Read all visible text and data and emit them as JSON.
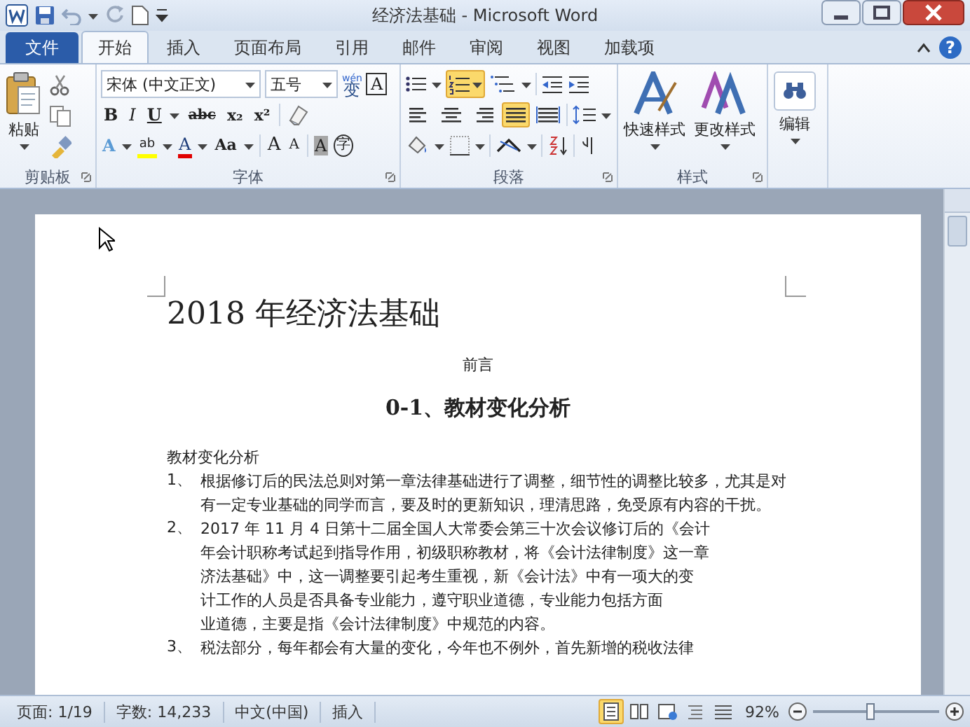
{
  "window": {
    "title": "经济法基础 - Microsoft Word",
    "help": "?"
  },
  "tabs": [
    {
      "label": "文件",
      "kind": "file",
      "selected": false
    },
    {
      "label": "开始",
      "kind": "tab",
      "selected": true
    },
    {
      "label": "插入",
      "kind": "tab",
      "selected": false
    },
    {
      "label": "页面布局",
      "kind": "tab",
      "selected": false
    },
    {
      "label": "引用",
      "kind": "tab",
      "selected": false
    },
    {
      "label": "邮件",
      "kind": "tab",
      "selected": false
    },
    {
      "label": "审阅",
      "kind": "tab",
      "selected": false
    },
    {
      "label": "视图",
      "kind": "tab",
      "selected": false
    },
    {
      "label": "加载项",
      "kind": "tab",
      "selected": false
    }
  ],
  "clipboard": {
    "label": "剪贴板",
    "paste": "粘贴"
  },
  "font": {
    "label": "字体",
    "font_name": "宋体 (中文正文)",
    "font_size": "五号",
    "phonetic": {
      "ruby": "wén",
      "base": "变"
    },
    "border_char": "A",
    "format_buttons": [
      {
        "label": "B",
        "kind": "bold"
      },
      {
        "label": "I",
        "kind": "italic"
      },
      {
        "label": "U",
        "kind": "underline"
      },
      {
        "label": "abc",
        "kind": "strike"
      },
      {
        "label": "x₂",
        "kind": "plain"
      },
      {
        "label": "x²",
        "kind": "plain"
      }
    ],
    "effect_buttons": [
      {
        "label": "A",
        "kind": "effects"
      },
      {
        "label": "ab",
        "kind": "highlight"
      },
      {
        "label": "A",
        "kind": "color"
      },
      {
        "label": "Aa",
        "kind": "plain"
      },
      {
        "label": "A",
        "kind": "grow"
      },
      {
        "label": "A",
        "kind": "shrink"
      },
      {
        "label": "A",
        "kind": "shade"
      },
      {
        "label": "字",
        "kind": "enclose"
      }
    ]
  },
  "paragraph": {
    "label": "段落",
    "numbering": {
      "selected": true
    },
    "align": [
      {
        "selected": false
      },
      {
        "selected": false
      },
      {
        "selected": false
      },
      {
        "selected": true
      },
      {
        "selected": false
      }
    ]
  },
  "styles": {
    "label": "样式",
    "quick": "快速样式",
    "change": "更改样式"
  },
  "editing": {
    "label": "编辑"
  },
  "document": {
    "heading": "2018 年经济法基础",
    "preface": "前言",
    "section": "0-1、教材变化分析",
    "subhead": "教材变化分析",
    "items": [
      {
        "number": "1、",
        "lines": [
          "根据修订后的民法总则对第一章法律基础进行了调整，细节性的调整比较多，尤其是对",
          "有一定专业基础的同学而言，要及时的更新知识，理清思路，免受原有内容的干扰。"
        ]
      },
      {
        "number": "2、",
        "lines": [
          "2017 年 11 月 4 日第十二届全国人大常委会第三十次会议修订后的《会计",
          "年会计职称考试起到指导作用，初级职称教材，将《会计法律制度》这一章",
          "济法基础》中，这一调整要引起考生重视，新《会计法》中有一项大的变",
          "计工作的人员是否具备专业能力，遵守职业道德，专业能力包括方面",
          "业道德，主要是指《会计法律制度》中规范的内容。"
        ]
      },
      {
        "number": "3、",
        "lines": [
          "税法部分，每年都会有大量的变化，今年也不例外，首先新增的税收法律"
        ]
      }
    ]
  },
  "status_bar": {
    "page": "页面: 1/19",
    "words": "字数: 14,233",
    "language": "中文(中国)",
    "mode": "插入",
    "views": [
      {
        "selected": true
      },
      {
        "selected": false
      },
      {
        "selected": false
      },
      {
        "selected": false
      },
      {
        "selected": false
      }
    ],
    "zoom": "92%",
    "zoom_slider": {
      "level": 0.45
    }
  }
}
